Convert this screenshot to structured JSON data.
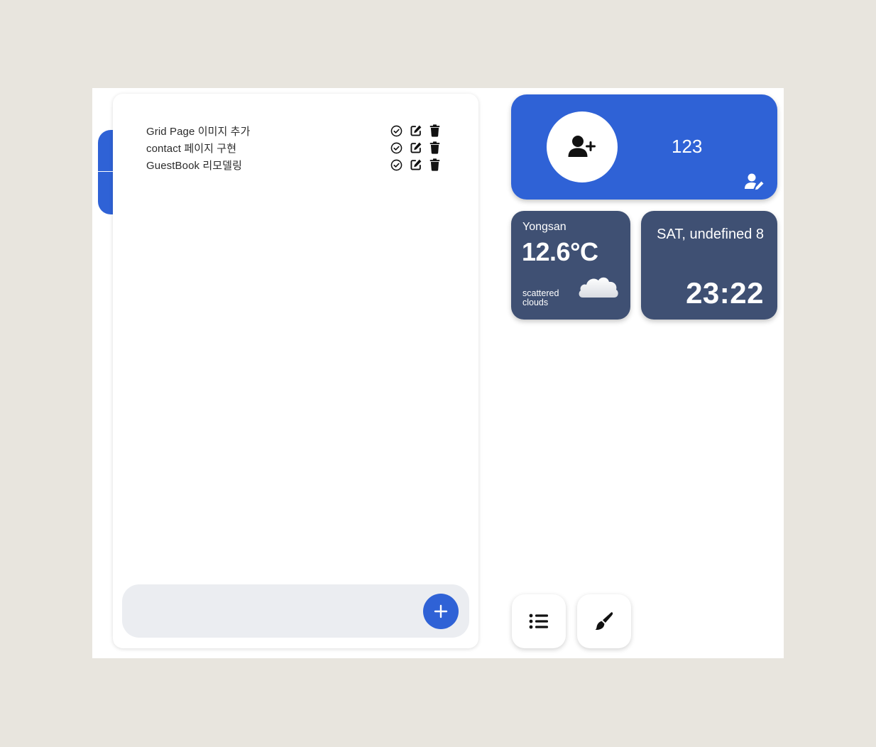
{
  "todos": {
    "items": [
      {
        "text": "Grid Page 이미지 추가"
      },
      {
        "text": "contact 페이지 구현"
      },
      {
        "text": "GuestBook 리모델링"
      }
    ],
    "input_value": "",
    "add_icon": "plus-icon",
    "action_icons": [
      "check-circle-icon",
      "edit-icon",
      "trash-icon"
    ]
  },
  "profile": {
    "name": "123",
    "avatar_icon": "user-plus-icon",
    "edit_icon": "user-edit-icon",
    "color": "#2f62d6"
  },
  "weather": {
    "city": "Yongsan",
    "temperature": "12.6°C",
    "description": "scattered clouds",
    "icon": "cloud-icon",
    "color": "#3f5073"
  },
  "clock": {
    "date": "SAT, undefined 8",
    "time": "23:22",
    "color": "#3f5073"
  },
  "toolbar": {
    "list_icon": "list-icon",
    "paint_icon": "paintbrush-icon"
  }
}
